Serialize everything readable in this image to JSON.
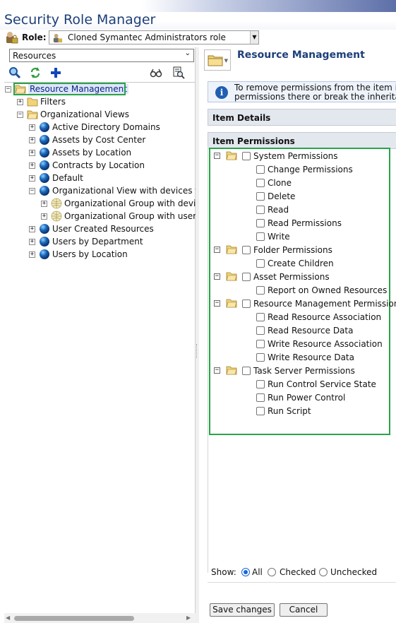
{
  "app_title": "Security Role Manager",
  "role": {
    "label": "Role:",
    "selected": "Cloned Symantec Administrators role"
  },
  "left_pane": {
    "resource_select": "Resources",
    "toolbar_icons": [
      "search-icon",
      "refresh-icon",
      "add-icon",
      "view-icon",
      "find-icon"
    ],
    "tree": [
      {
        "label": "Resource Management",
        "depth": 0,
        "expander": "−",
        "icon": "folder-open-icon",
        "selected": true
      },
      {
        "label": "Filters",
        "depth": 1,
        "expander": "+",
        "icon": "folder-icon"
      },
      {
        "label": "Organizational Views",
        "depth": 1,
        "expander": "−",
        "icon": "folder-open-icon"
      },
      {
        "label": "Active Directory Domains",
        "depth": 2,
        "expander": "+",
        "icon": "globe-icon"
      },
      {
        "label": "Assets by Cost Center",
        "depth": 2,
        "expander": "+",
        "icon": "globe-icon"
      },
      {
        "label": "Assets by Location",
        "depth": 2,
        "expander": "+",
        "icon": "globe-icon"
      },
      {
        "label": "Contracts by Location",
        "depth": 2,
        "expander": "+",
        "icon": "globe-icon"
      },
      {
        "label": "Default",
        "depth": 2,
        "expander": "+",
        "icon": "globe-icon"
      },
      {
        "label": "Organizational View with devices for",
        "depth": 2,
        "expander": "−",
        "icon": "globe-icon"
      },
      {
        "label": "Organizational Group with device",
        "depth": 3,
        "expander": "+",
        "icon": "group-icon"
      },
      {
        "label": "Organizational Group with users",
        "depth": 3,
        "expander": "+",
        "icon": "group-icon"
      },
      {
        "label": "User Created Resources",
        "depth": 2,
        "expander": "+",
        "icon": "globe-icon"
      },
      {
        "label": "Users by Department",
        "depth": 2,
        "expander": "+",
        "icon": "globe-icon"
      },
      {
        "label": "Users by Location",
        "depth": 2,
        "expander": "+",
        "icon": "globe-icon"
      }
    ]
  },
  "right_pane": {
    "title": "Resource Management",
    "info_line1": "To remove permissions from the item in o",
    "info_line2": "permissions there or break the inheritan",
    "item_details_header": "Item Details",
    "item_permissions_header": "Item Permissions",
    "permission_groups": [
      {
        "label": "System Permissions",
        "items": [
          "Change Permissions",
          "Clone",
          "Delete",
          "Read",
          "Read Permissions",
          "Write"
        ]
      },
      {
        "label": "Folder Permissions",
        "items": [
          "Create Children"
        ]
      },
      {
        "label": "Asset Permissions",
        "items": [
          "Report on Owned Resources"
        ]
      },
      {
        "label": "Resource Management Permissions",
        "items": [
          "Read Resource Association",
          "Read Resource Data",
          "Write Resource Association",
          "Write Resource Data"
        ]
      },
      {
        "label": "Task Server Permissions",
        "items": [
          "Run Control Service State",
          "Run Power Control",
          "Run Script"
        ]
      }
    ],
    "show": {
      "label": "Show:",
      "options": [
        "All",
        "Checked",
        "Unchecked"
      ],
      "selected": "All"
    },
    "buttons": {
      "save": "Save changes",
      "cancel": "Cancel"
    }
  },
  "colors": {
    "title": "#1d3f7a",
    "highlight": "#2aa34a",
    "header_bg": "#e3e7ee"
  }
}
